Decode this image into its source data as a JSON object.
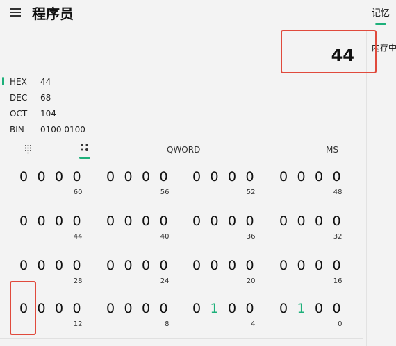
{
  "header": {
    "title": "程序员",
    "menu_icon": "hamburger-icon"
  },
  "display": {
    "value": "44"
  },
  "side_panel": {
    "tab_label": "记忆",
    "text": "内存中"
  },
  "radix": [
    {
      "label": "HEX",
      "value": "44"
    },
    {
      "label": "DEC",
      "value": "68"
    },
    {
      "label": "OCT",
      "value": "104"
    },
    {
      "label": "BIN",
      "value": "0100 0100"
    }
  ],
  "toolbar": {
    "keypad_icon": "full-keypad-icon",
    "bitflip_icon": "bit-toggle-keypad-icon",
    "word_size": "QWORD",
    "memory_store": "MS"
  },
  "bit_grid": {
    "rows": [
      {
        "bits": [
          "0",
          "0",
          "0",
          "0",
          "0",
          "0",
          "0",
          "0",
          "0",
          "0",
          "0",
          "0",
          "0",
          "0",
          "0",
          "0"
        ],
        "positions": [
          "60",
          "56",
          "52",
          "48"
        ]
      },
      {
        "bits": [
          "0",
          "0",
          "0",
          "0",
          "0",
          "0",
          "0",
          "0",
          "0",
          "0",
          "0",
          "0",
          "0",
          "0",
          "0",
          "0"
        ],
        "positions": [
          "44",
          "40",
          "36",
          "32"
        ]
      },
      {
        "bits": [
          "0",
          "0",
          "0",
          "0",
          "0",
          "0",
          "0",
          "0",
          "0",
          "0",
          "0",
          "0",
          "0",
          "0",
          "0",
          "0"
        ],
        "positions": [
          "28",
          "24",
          "20",
          "16"
        ]
      },
      {
        "bits": [
          "0",
          "0",
          "0",
          "0",
          "0",
          "0",
          "0",
          "0",
          "0",
          "1",
          "0",
          "0",
          "0",
          "1",
          "0",
          "0"
        ],
        "positions": [
          "12",
          "8",
          "4",
          "0"
        ]
      }
    ]
  },
  "colors": {
    "accent": "#1db07a",
    "highlight_box": "#e04a3c"
  }
}
